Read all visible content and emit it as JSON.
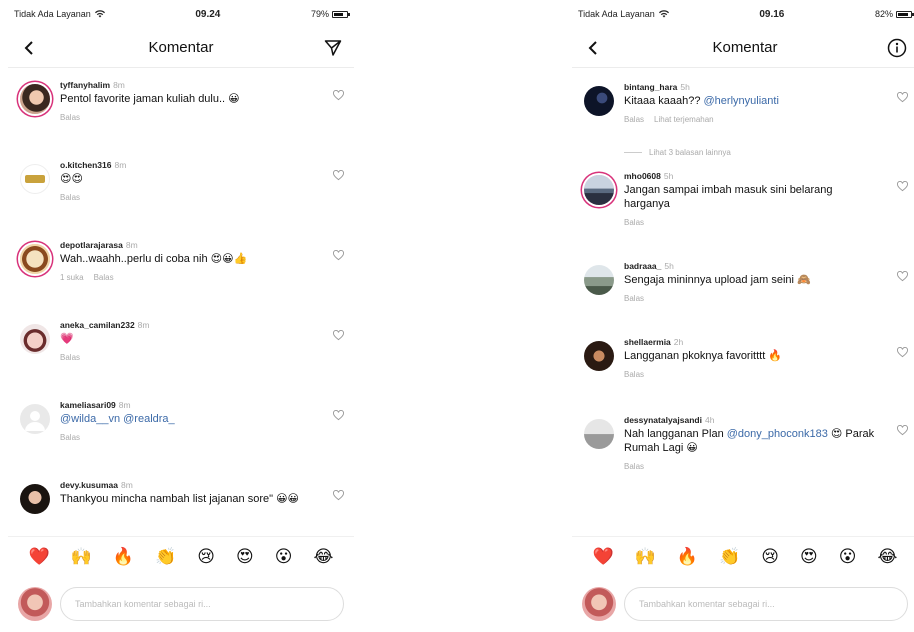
{
  "left_screen": {
    "status": {
      "carrier": "Tidak Ada Layanan",
      "time": "09.24",
      "battery": "79%",
      "battery_level": 0.79
    },
    "title": "Komentar",
    "comments": [
      {
        "user": "tyffanyhalim",
        "time": "8m",
        "text": "Pentol favorite jaman kuliah dulu.. 😀",
        "actions": [
          "Balas"
        ]
      },
      {
        "user": "o.kitchen316",
        "time": "8m",
        "text": "😍😍",
        "actions": [
          "Balas"
        ]
      },
      {
        "user": "depotlarajarasa",
        "time": "8m",
        "text": "Wah..waahh..perlu di coba nih 😍😀👍",
        "actions": [
          "1 suka",
          "Balas"
        ]
      },
      {
        "user": "aneka_camilan232",
        "time": "8m",
        "text": "💗",
        "actions": [
          "Balas"
        ]
      },
      {
        "user": "kameliasari09",
        "time": "8m",
        "text": "@wilda__vn @realdra_",
        "actions": [
          "Balas"
        ]
      },
      {
        "user": "devy.kusumaa",
        "time": "8m",
        "text": "Thankyou mincha nambah list jajanan sore\" 😀😀",
        "actions": []
      }
    ],
    "emojis": [
      "❤️",
      "🙌",
      "🔥",
      "👏",
      "😢",
      "😍",
      "😮",
      "😂"
    ],
    "input_placeholder": "Tambahkan komentar sebagai ri..."
  },
  "right_screen": {
    "status": {
      "carrier": "Tidak Ada Layanan",
      "time": "09.16",
      "battery": "82%",
      "battery_level": 0.82
    },
    "title": "Komentar",
    "comments": [
      {
        "user": "bintang_hara",
        "time": "5h",
        "text_parts": [
          "Kitaaa kaaah?? ",
          "@herlynyulianti"
        ],
        "actions": [
          "Balas",
          "Lihat terjemahan"
        ],
        "replies": "Lihat 3 balasan lainnya"
      },
      {
        "user": "mho0608",
        "time": "5h",
        "text": "Jangan sampai imbah masuk sini belarang harganya",
        "actions": [
          "Balas"
        ]
      },
      {
        "user": "badraaa_",
        "time": "5h",
        "text": "Sengaja mininnya upload jam seini 🙈",
        "actions": [
          "Balas"
        ]
      },
      {
        "user": "shellaermia",
        "time": "2h",
        "text": "Langganan pkoknya favoritttt 🔥",
        "actions": [
          "Balas"
        ]
      },
      {
        "user": "dessynatalyajsandi",
        "time": "4h",
        "text_parts": [
          "Nah langganan Plan ",
          "@dony_phoconk183",
          " 😍 Parak Rumah Lagi 😀"
        ],
        "actions": [
          "Balas"
        ]
      }
    ],
    "emojis": [
      "❤️",
      "🙌",
      "🔥",
      "👏",
      "😢",
      "😍",
      "😮",
      "😂"
    ],
    "input_placeholder": "Tambahkan komentar sebagai ri..."
  },
  "colors": {
    "accent": "#3c6aa8",
    "ring": "#d8327a",
    "muted": "#aaaaaa"
  }
}
